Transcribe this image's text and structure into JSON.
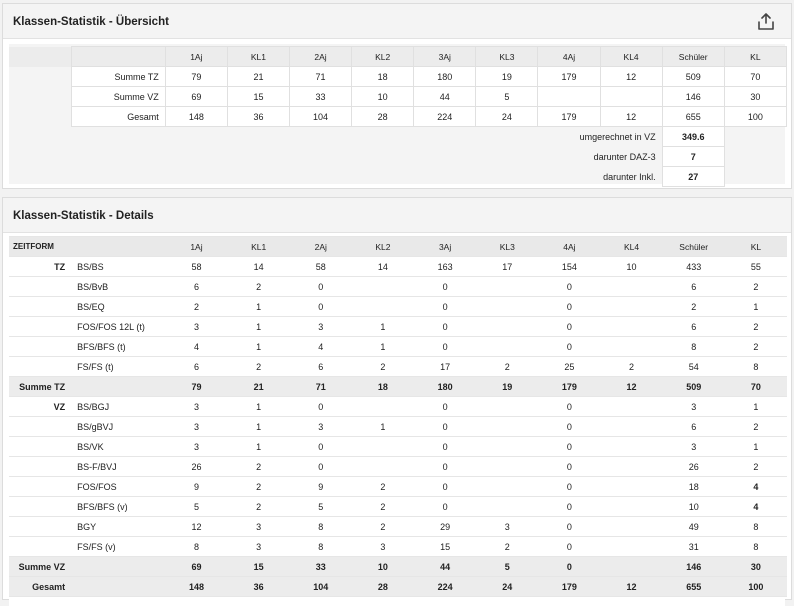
{
  "overview": {
    "title": "Klassen-Statistik - Übersicht",
    "export_icon": "export-tray-icon",
    "columns": [
      "1Aj",
      "KL1",
      "2Aj",
      "KL2",
      "3Aj",
      "KL3",
      "4Aj",
      "KL4",
      "Schüler",
      "KL"
    ],
    "rows": [
      {
        "label": "Summe TZ",
        "values": [
          "79",
          "21",
          "71",
          "18",
          "180",
          "19",
          "179",
          "12",
          "509",
          "70"
        ]
      },
      {
        "label": "Summe VZ",
        "values": [
          "69",
          "15",
          "33",
          "10",
          "44",
          "5",
          "",
          "",
          "146",
          "30"
        ]
      },
      {
        "label": "Gesamt",
        "values": [
          "148",
          "36",
          "104",
          "28",
          "224",
          "24",
          "179",
          "12",
          "655",
          "100"
        ]
      }
    ],
    "extras": [
      {
        "label": "umgerechnet in VZ",
        "value": "349.6"
      },
      {
        "label": "darunter DAZ-3",
        "value": "7"
      },
      {
        "label": "darunter Inkl.",
        "value": "27"
      }
    ]
  },
  "details": {
    "title": "Klassen-Statistik - Details",
    "header_first": "ZEITFORM",
    "columns": [
      "1Aj",
      "KL1",
      "2Aj",
      "KL2",
      "3Aj",
      "KL3",
      "4Aj",
      "KL4",
      "Schüler",
      "KL"
    ],
    "groups": [
      {
        "name": "TZ",
        "rows": [
          {
            "school": "BS/BS",
            "values": [
              "58",
              "14",
              "58",
              "14",
              "163",
              "17",
              "154",
              "10",
              "433",
              "55"
            ]
          },
          {
            "school": "BS/BvB",
            "values": [
              "6",
              "2",
              "0",
              "",
              "0",
              "",
              "0",
              "",
              "6",
              "2"
            ]
          },
          {
            "school": "BS/EQ",
            "values": [
              "2",
              "1",
              "0",
              "",
              "0",
              "",
              "0",
              "",
              "2",
              "1"
            ]
          },
          {
            "school": "FOS/FOS 12L (t)",
            "values": [
              "3",
              "1",
              "3",
              "1",
              "0",
              "",
              "0",
              "",
              "6",
              "2"
            ]
          },
          {
            "school": "BFS/BFS (t)",
            "values": [
              "4",
              "1",
              "4",
              "1",
              "0",
              "",
              "0",
              "",
              "8",
              "2"
            ]
          },
          {
            "school": "FS/FS (t)",
            "values": [
              "6",
              "2",
              "6",
              "2",
              "17",
              "2",
              "25",
              "2",
              "54",
              "8"
            ]
          }
        ],
        "sum": {
          "label": "Summe TZ",
          "values": [
            "79",
            "21",
            "71",
            "18",
            "180",
            "19",
            "179",
            "12",
            "509",
            "70"
          ]
        }
      },
      {
        "name": "VZ",
        "rows": [
          {
            "school": "BS/BGJ",
            "values": [
              "3",
              "1",
              "0",
              "",
              "0",
              "",
              "0",
              "",
              "3",
              "1"
            ]
          },
          {
            "school": "BS/gBVJ",
            "values": [
              "3",
              "1",
              "3",
              "1",
              "0",
              "",
              "0",
              "",
              "6",
              "2"
            ]
          },
          {
            "school": "BS/VK",
            "values": [
              "3",
              "1",
              "0",
              "",
              "0",
              "",
              "0",
              "",
              "3",
              "1"
            ]
          },
          {
            "school": "BS-F/BVJ",
            "values": [
              "26",
              "2",
              "0",
              "",
              "0",
              "",
              "0",
              "",
              "26",
              "2"
            ]
          },
          {
            "school": "FOS/FOS",
            "values": [
              "9",
              "2",
              "9",
              "2",
              "0",
              "",
              "0",
              "",
              "18",
              "4"
            ]
          },
          {
            "school": "BFS/BFS (v)",
            "values": [
              "5",
              "2",
              "5",
              "2",
              "0",
              "",
              "0",
              "",
              "10",
              "4"
            ]
          },
          {
            "school": "BGY",
            "values": [
              "12",
              "3",
              "8",
              "2",
              "29",
              "3",
              "0",
              "",
              "49",
              "8"
            ]
          },
          {
            "school": "FS/FS (v)",
            "values": [
              "8",
              "3",
              "8",
              "3",
              "15",
              "2",
              "0",
              "",
              "31",
              "8"
            ]
          }
        ],
        "sum": {
          "label": "Summe VZ",
          "values": [
            "69",
            "15",
            "33",
            "10",
            "44",
            "5",
            "0",
            "",
            "146",
            "30"
          ]
        }
      }
    ],
    "total": {
      "label": "Gesamt",
      "values": [
        "148",
        "36",
        "104",
        "28",
        "224",
        "24",
        "179",
        "12",
        "655",
        "100"
      ]
    }
  }
}
